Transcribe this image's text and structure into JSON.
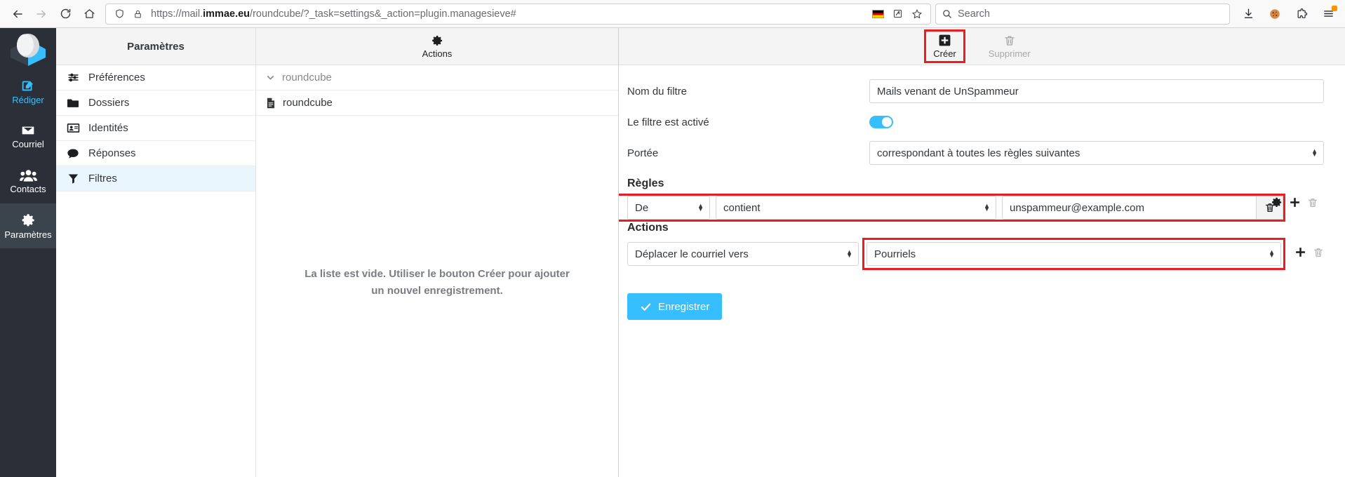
{
  "browser": {
    "back_title": "Back",
    "forward_title": "Forward",
    "reload_title": "Reload",
    "home_title": "Home",
    "url": "https://mail.immae.eu/roundcube/?_task=settings&_action=plugin.managesieve#",
    "url_host_bold": "immae.eu",
    "url_prefix": "https://mail.",
    "url_suffix": "/roundcube/?_task=settings&_action=plugin.managesieve#",
    "search_placeholder": "Search",
    "shield_title": "Tracking protection",
    "lock_title": "Secure connection",
    "translate_title": "Translate page",
    "reader_title": "Reader view",
    "bookmark_title": "Bookmark this page",
    "language_flag": "German flag",
    "downloads_title": "Downloads",
    "cookies_title": "Cookies",
    "extensions_title": "Extensions",
    "menu_title": "Application menu"
  },
  "tasks": [
    {
      "name": "compose",
      "label": "Rédiger",
      "accent": true,
      "active": false
    },
    {
      "name": "mail",
      "label": "Courriel",
      "accent": false,
      "active": false
    },
    {
      "name": "contacts",
      "label": "Contacts",
      "accent": false,
      "active": false
    },
    {
      "name": "settings",
      "label": "Paramètres",
      "accent": false,
      "active": true
    }
  ],
  "settings": {
    "title": "Paramètres",
    "items": [
      {
        "name": "preferences",
        "label": "Préférences",
        "selected": false
      },
      {
        "name": "folders",
        "label": "Dossiers",
        "selected": false
      },
      {
        "name": "identities",
        "label": "Identités",
        "selected": false
      },
      {
        "name": "responses",
        "label": "Réponses",
        "selected": false
      },
      {
        "name": "filters",
        "label": "Filtres",
        "selected": true
      }
    ]
  },
  "filters_panel": {
    "actions_label": "Actions",
    "filter_set_label": "roundcube",
    "filter_item_label": "roundcube",
    "empty_message": "La liste est vide. Utiliser le bouton Créer pour ajouter un nouvel enregistrement."
  },
  "form_toolbar": {
    "create_label": "Créer",
    "delete_label": "Supprimer"
  },
  "form": {
    "name_label": "Nom du filtre",
    "name_value": "Mails venant de UnSpammeur",
    "enabled_label": "Le filtre est activé",
    "enabled": true,
    "scope_label": "Portée",
    "scope_value": "correspondant à toutes les règles suivantes",
    "rules_title": "Règles",
    "rules": [
      {
        "header": "De",
        "operator": "contient",
        "value": "unspammeur@example.com"
      }
    ],
    "actions_title": "Actions",
    "actions": [
      {
        "action": "Déplacer le courriel vers",
        "target": "Pourriels"
      }
    ],
    "save_label": "Enregistrer"
  },
  "colors": {
    "accent": "#37beff",
    "highlight": "#ec1c24",
    "taskbar": "#2b3038",
    "panel_header": "#f4f4f4",
    "selected_row": "#eaf6fd"
  }
}
